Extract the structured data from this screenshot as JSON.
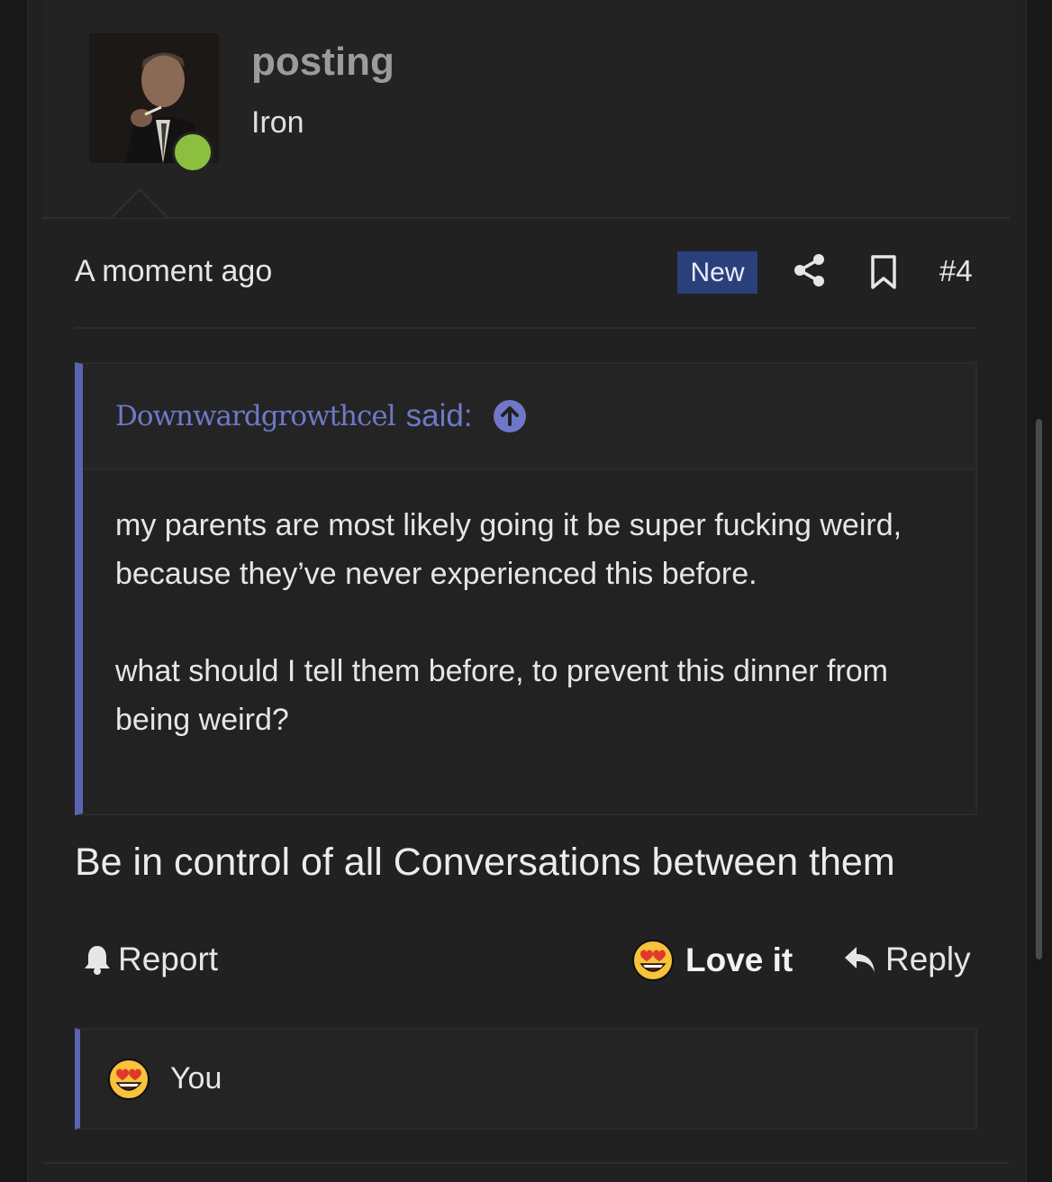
{
  "user": {
    "name": "posting",
    "title": "Iron",
    "online": true,
    "online_color": "#8cbf3f"
  },
  "meta": {
    "timestamp": "A moment ago",
    "badge": "New",
    "post_number": "#4",
    "icons": [
      "share-icon",
      "bookmark-icon"
    ]
  },
  "quote": {
    "author": "Downwardgrowthcel",
    "said": "said:",
    "paragraphs": [
      "my parents are most likely going it be super fucking weird, because they’ve never experienced this before.",
      "what should I tell them before, to prevent this dinner from being weird?"
    ],
    "accent_color": "#5c63b0"
  },
  "post_body": "Be in control of all Conversations between them",
  "actions": {
    "report": "Report",
    "reaction": "Love it",
    "reply": "Reply"
  },
  "reactions": {
    "users": "You"
  }
}
